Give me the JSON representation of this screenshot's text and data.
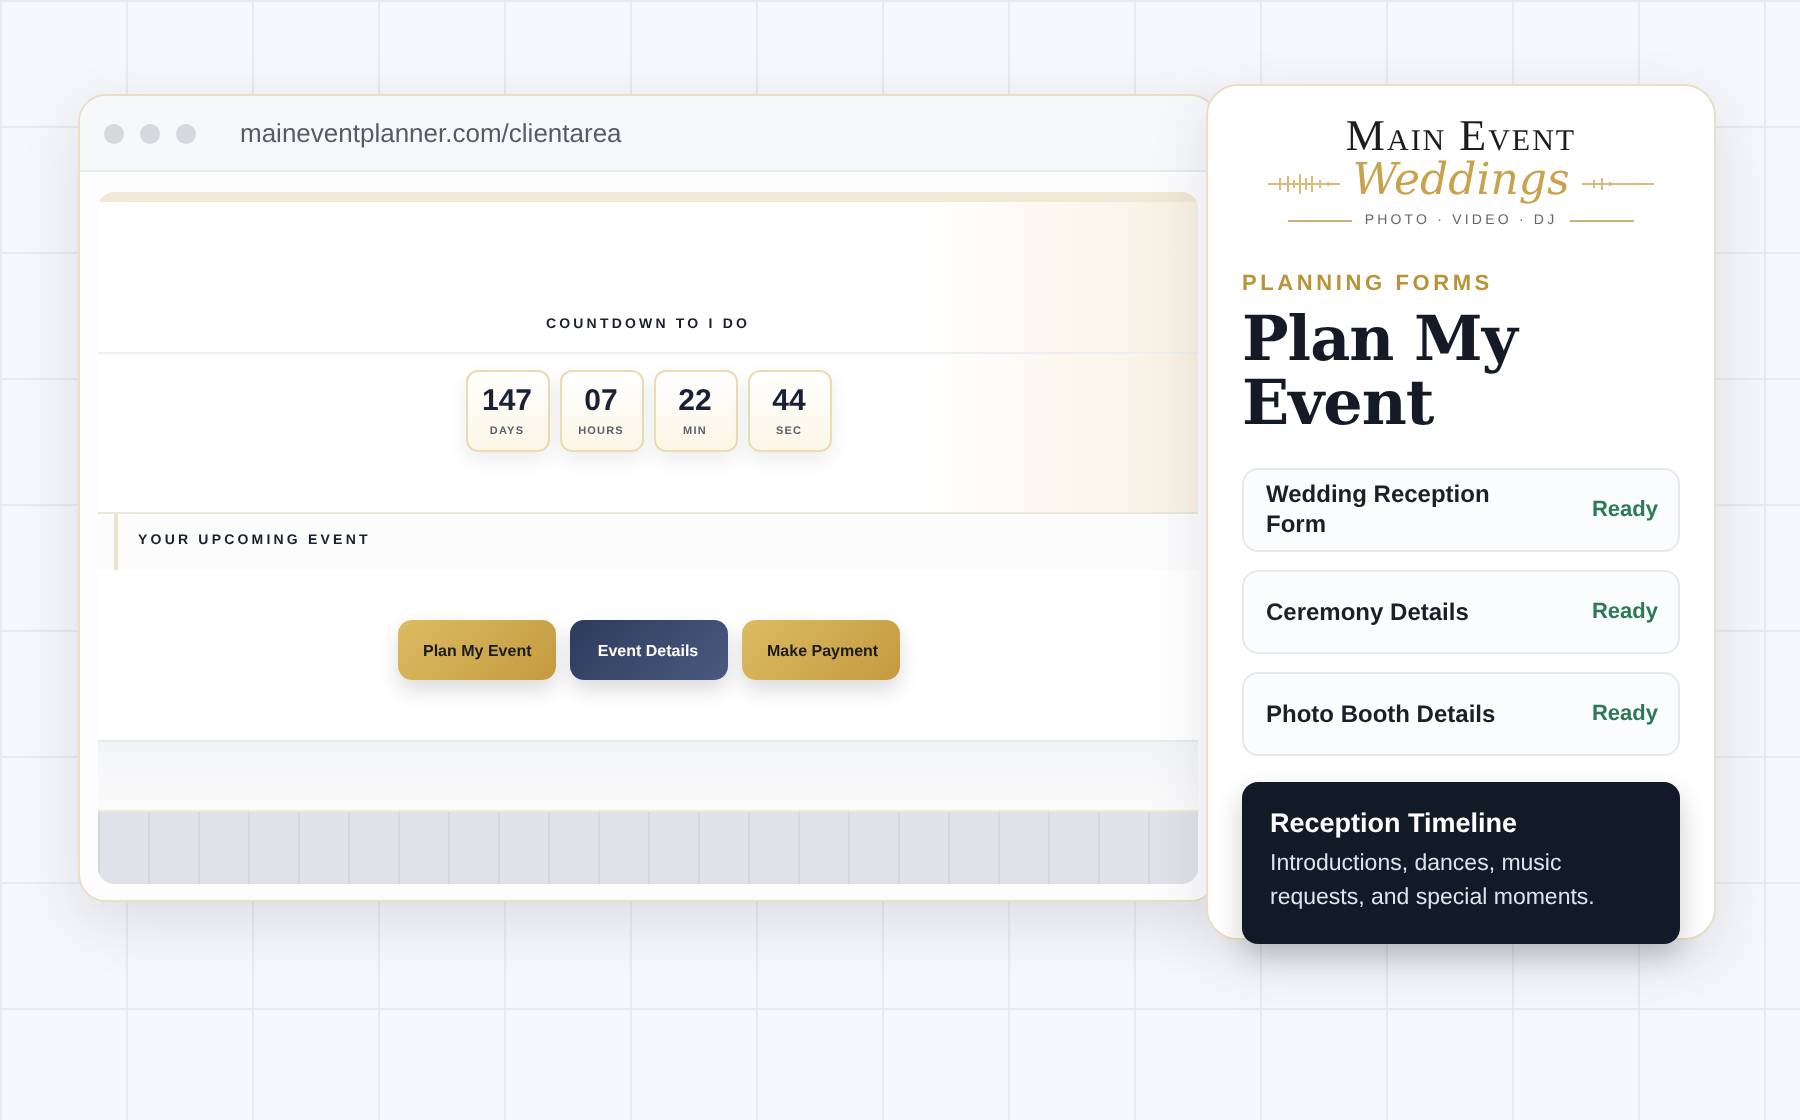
{
  "browser": {
    "url": "maineventplanner.com/clientarea",
    "countdown": {
      "title": "COUNTDOWN TO I DO",
      "units": [
        {
          "value": "147",
          "label": "DAYS"
        },
        {
          "value": "07",
          "label": "HOURS"
        },
        {
          "value": "22",
          "label": "MIN"
        },
        {
          "value": "44",
          "label": "SEC"
        }
      ]
    },
    "event_heading": "YOUR UPCOMING EVENT",
    "buttons": [
      {
        "label": "Plan My Event",
        "kind": "gold"
      },
      {
        "label": "Event Details",
        "kind": "navy"
      },
      {
        "label": "Make Payment",
        "kind": "gold"
      }
    ]
  },
  "panel": {
    "logo": {
      "name": "Main Event",
      "script": "Weddings",
      "tagline": "PHOTO · VIDEO · DJ"
    },
    "eyebrow": "PLANNING FORMS",
    "title": "Plan My Event",
    "forms": [
      {
        "kind": "form",
        "title": "Wedding Reception Form",
        "status": "Ready"
      },
      {
        "kind": "form",
        "title": "Ceremony Details",
        "status": "Ready"
      },
      {
        "kind": "form",
        "title": "Photo Booth Details",
        "status": "Ready"
      },
      {
        "kind": "highlight",
        "title": "Reception Timeline",
        "description": "Introductions, dances, music requests, and special moments."
      }
    ]
  }
}
